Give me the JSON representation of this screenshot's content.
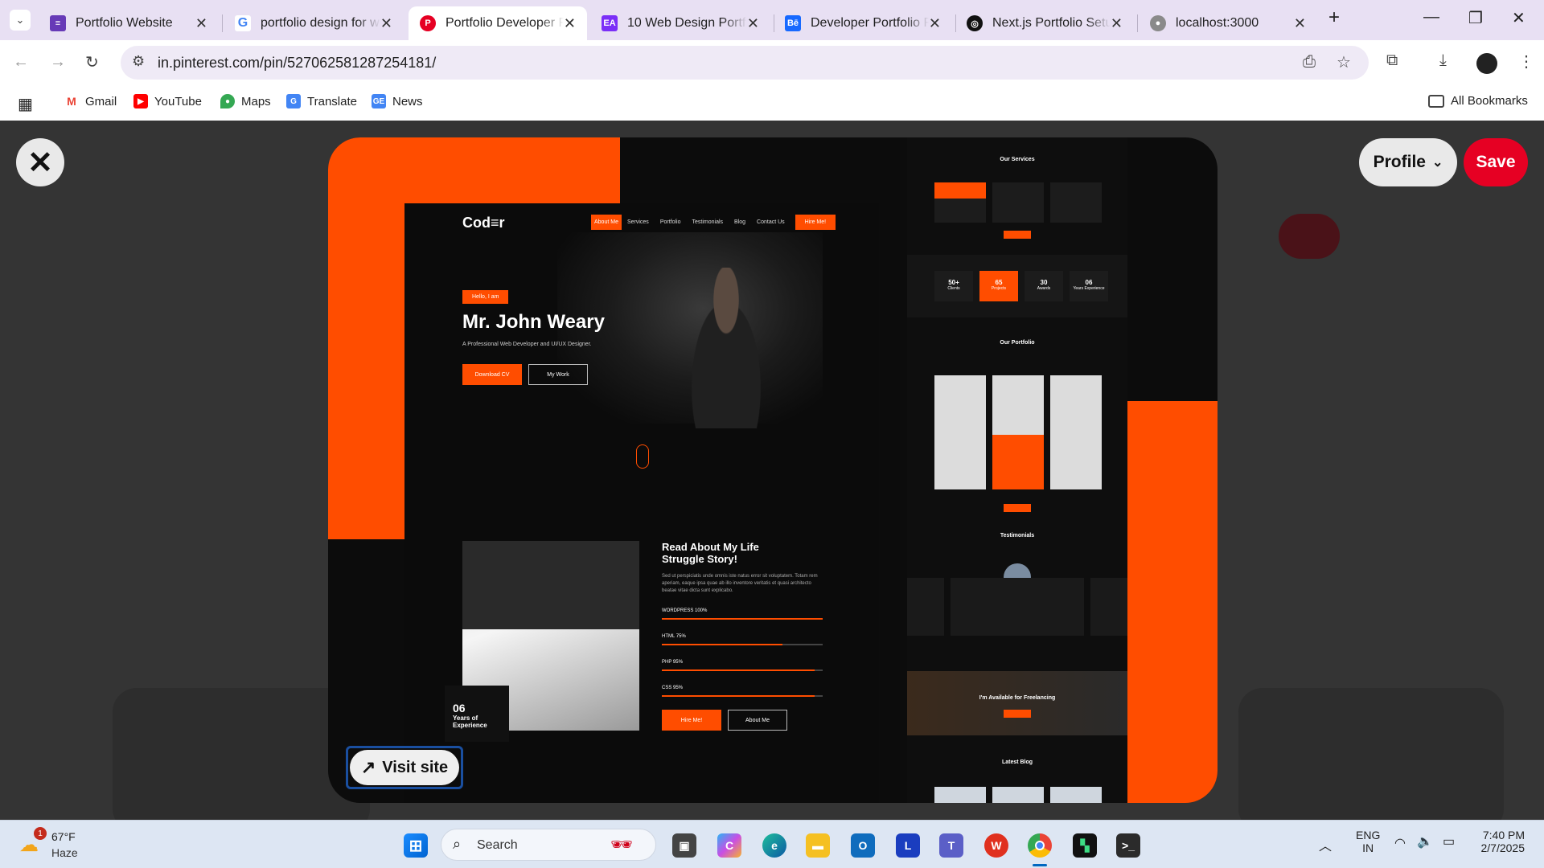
{
  "browser": {
    "tabs": [
      {
        "title": "Portfolio Website",
        "icon": "forms-icon"
      },
      {
        "title": "portfolio design for w",
        "icon": "google-icon"
      },
      {
        "title": "Portfolio Developer F",
        "icon": "pinterest-icon"
      },
      {
        "title": "10 Web Design Portf",
        "icon": "site-icon"
      },
      {
        "title": "Developer Portfolio F",
        "icon": "behance-icon"
      },
      {
        "title": "Next.js Portfolio Setu",
        "icon": "chatgpt-icon"
      },
      {
        "title": "localhost:3000",
        "icon": "globe-icon"
      }
    ],
    "url": "in.pinterest.com/pin/527062581287254181/",
    "bookmarks": [
      "Gmail",
      "YouTube",
      "Maps",
      "Translate",
      "News"
    ],
    "all_bookmarks": "All Bookmarks"
  },
  "pin": {
    "profile_label": "Profile",
    "save_label": "Save",
    "visit_label": "Visit site",
    "site": {
      "logo": "Cod≡r",
      "nav": [
        "About Me",
        "Services",
        "Portfolio",
        "Testimonials",
        "Blog",
        "Contact Us"
      ],
      "hire": "Hire Me!",
      "greeting": "Hello, I am",
      "name": "Mr. John Weary",
      "tagline": "A Professional Web Developer and UI/UX Designer.",
      "download_cv": "Download CV",
      "my_work": "My Work",
      "story_title": "Read About My Life Struggle Story!",
      "story_text": "Sed ut perspiciatis unde omnis iste natus error sit voluptatem. Totam rem aperiam, eaque ipsa quae ab illo inventore veritatis et quasi architecto beatae vitae dicta sunt explicabo.",
      "skills": [
        {
          "name": "WORDPRESS",
          "pct": 100
        },
        {
          "name": "HTML",
          "pct": 75
        },
        {
          "name": "PHP",
          "pct": 95
        },
        {
          "name": "CSS",
          "pct": 95
        }
      ],
      "years": "06",
      "years_label": "Years of Experience",
      "hire_btn": "Hire Me!",
      "about_btn": "About Me"
    },
    "side": {
      "services_title": "Our Services",
      "stats": [
        {
          "v": "50+",
          "l": "Clients"
        },
        {
          "v": "65",
          "l": "Projects"
        },
        {
          "v": "30",
          "l": "Awards"
        },
        {
          "v": "06",
          "l": "Years Experience"
        }
      ],
      "portfolio_title": "Our Portfolio",
      "testimonials_title": "Testimonials",
      "freelance": "I'm Available for Freelancing",
      "blog_title": "Latest Blog"
    }
  },
  "taskbar": {
    "weather_temp": "67°F",
    "weather_desc": "Haze",
    "weather_badge": "1",
    "search": "Search",
    "lang1": "ENG",
    "lang2": "IN",
    "time": "7:40 PM",
    "date": "2/7/2025"
  }
}
